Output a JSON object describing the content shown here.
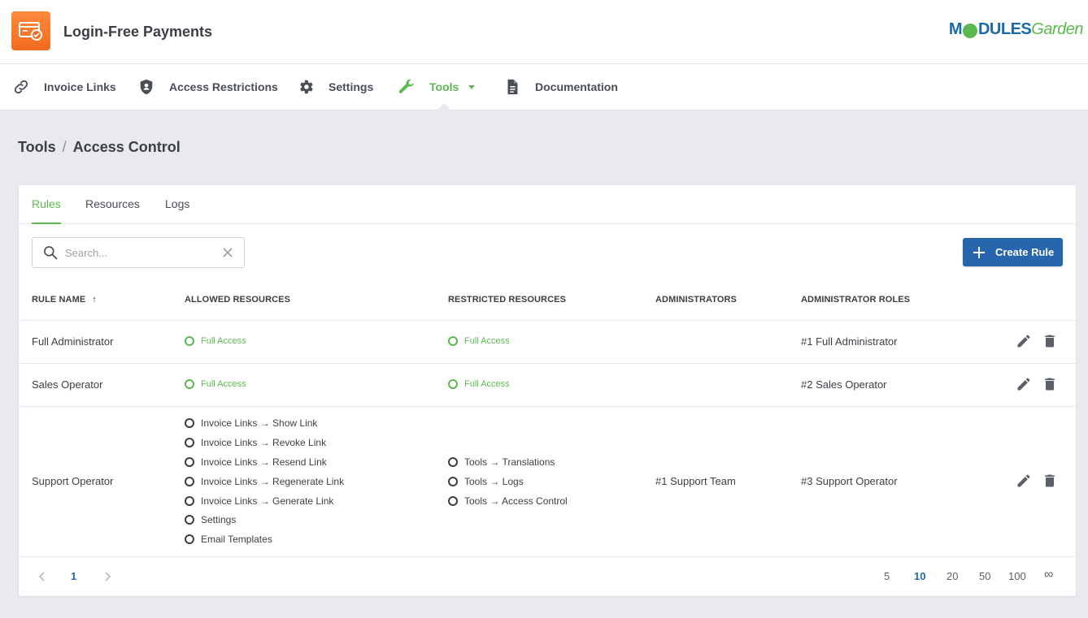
{
  "header": {
    "title": "Login-Free Payments",
    "brand": {
      "part1": "M",
      "part2": "DULES",
      "part3": "Garden"
    }
  },
  "nav": {
    "items": [
      {
        "label": "Invoice Links",
        "icon": "link-icon"
      },
      {
        "label": "Access Restrictions",
        "icon": "shield-icon"
      },
      {
        "label": "Settings",
        "icon": "gear-icon"
      },
      {
        "label": "Tools",
        "icon": "wrench-icon",
        "active": true
      },
      {
        "label": "Documentation",
        "icon": "document-icon"
      }
    ]
  },
  "breadcrumb": {
    "parent": "Tools",
    "separator": "/",
    "current": "Access Control"
  },
  "tabs": [
    {
      "label": "Rules",
      "active": true
    },
    {
      "label": "Resources"
    },
    {
      "label": "Logs"
    }
  ],
  "search": {
    "placeholder": "Search...",
    "value": ""
  },
  "create_button": {
    "label": "Create Rule"
  },
  "table": {
    "headers": [
      "Rule Name",
      "Allowed Resources",
      "Restricted Resources",
      "Administrators",
      "Administrator Roles"
    ],
    "sort_indicator": "↑",
    "rows": [
      {
        "name": "Full Administrator",
        "allowed": [
          "Full Access"
        ],
        "restricted": [
          "Full Access"
        ],
        "administrators": "",
        "roles": "#1 Full Administrator"
      },
      {
        "name": "Sales Operator",
        "allowed": [
          "Full Access"
        ],
        "restricted": [
          "Full Access"
        ],
        "administrators": "",
        "roles": "#2 Sales Operator"
      },
      {
        "name": "Support Operator",
        "allowed": [
          "Invoice Links → Show Link",
          "Invoice Links → Revoke Link",
          "Invoice Links → Resend Link",
          "Invoice Links → Regenerate Link",
          "Invoice Links → Generate Link",
          "Settings",
          "Email Templates"
        ],
        "restricted": [
          "Tools → Translations",
          "Tools → Logs",
          "Tools → Access Control"
        ],
        "administrators": "#1 Support Team",
        "roles": "#3 Support Operator"
      }
    ]
  },
  "pagination": {
    "current_page": "1",
    "page_sizes": [
      "5",
      "10",
      "20",
      "50",
      "100",
      "∞"
    ],
    "selected_size": "10"
  },
  "colors": {
    "accent_green": "#5bb94f",
    "primary_blue": "#2766ad",
    "logo_orange": "#f26a1f"
  }
}
